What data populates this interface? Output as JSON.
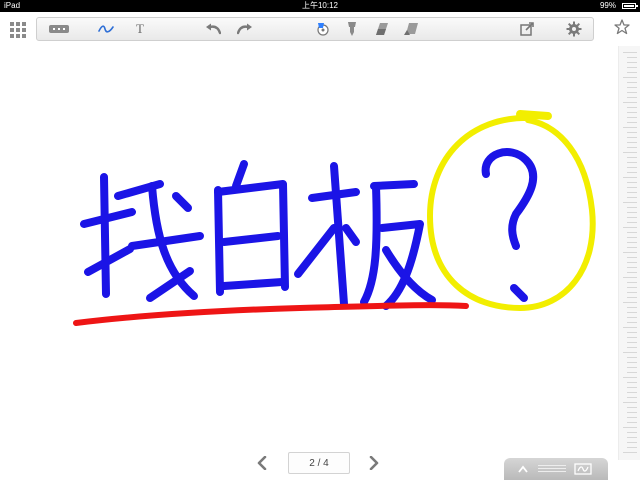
{
  "status_bar": {
    "device": "iPad",
    "time": "上午10:12",
    "battery": "99%",
    "battery_level": 0.99
  },
  "toolbar": {
    "items": [
      {
        "name": "grid-menu",
        "icon": "grid-icon"
      },
      {
        "name": "pen-width",
        "icon": "line-width-icon"
      },
      {
        "name": "pen-tool",
        "icon": "pen-icon",
        "color": "#2f6fd6"
      },
      {
        "name": "text-tool",
        "icon": "text-icon",
        "label": "T"
      },
      {
        "name": "undo",
        "icon": "undo-icon"
      },
      {
        "name": "redo",
        "icon": "redo-icon"
      },
      {
        "name": "color-picker",
        "icon": "palette-icon"
      },
      {
        "name": "highlighter",
        "icon": "highlighter-icon"
      },
      {
        "name": "eraser",
        "icon": "eraser-icon"
      },
      {
        "name": "clear-page",
        "icon": "clear-icon"
      },
      {
        "name": "export",
        "icon": "export-icon"
      },
      {
        "name": "settings",
        "icon": "gear-icon"
      },
      {
        "name": "favorite",
        "icon": "star-icon"
      }
    ]
  },
  "canvas": {
    "handwriting": "找白板",
    "question_mark": "?",
    "ink_colors": {
      "text": "#1b14e6",
      "circle": "#f2ee00",
      "underline": "#ee1515"
    }
  },
  "pager": {
    "current": 2,
    "total": 4,
    "label": "2 / 4"
  }
}
